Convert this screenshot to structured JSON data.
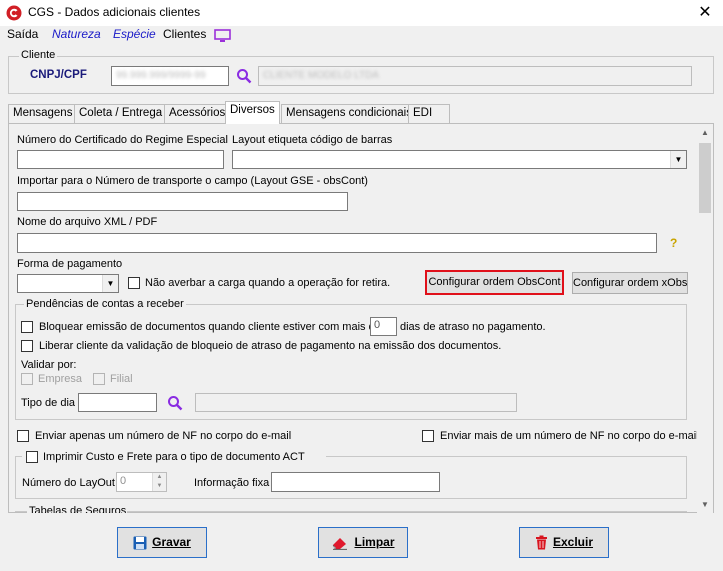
{
  "window": {
    "title": "CGS - Dados adicionais clientes",
    "close_glyph": "✕"
  },
  "menu": {
    "items": [
      "Saída",
      "Natureza",
      "Espécie",
      "Clientes"
    ],
    "monitor_icon": "monitor-icon"
  },
  "cliente": {
    "group_label": "Cliente",
    "cnpj_label": "CNPJ/CPF",
    "cnpj_value": "99.999.999/9999-99",
    "name_value": "CLIENTE MODELO LTDA"
  },
  "tabs": [
    "Mensagens",
    "Coleta / Entrega",
    "Acessórios",
    "Diversos",
    "Mensagens condicionais",
    "EDI"
  ],
  "diversos": {
    "cert_label": "Número do Certificado do Regime Especial",
    "cert_value": "",
    "layout_label": "Layout etiqueta código de barras",
    "layout_value": "",
    "import_label": "Importar para o Número de transporte o campo (Layout GSE - obsCont)",
    "import_value": "",
    "xml_label": "Nome do arquivo XML / PDF",
    "xml_value": "",
    "help_glyph": "?",
    "forma_label": "Forma de pagamento",
    "forma_value": "",
    "nao_averbar_label": "Não averbar a carga quando a operação for retira.",
    "btn_obscont": "Configurar ordem ObsCont",
    "btn_xobs": "Configurar ordem xObs",
    "pendencias": {
      "group_label": "Pendências de contas a receber",
      "bloquear_label": "Bloquear emissão de documentos quando cliente estiver com mais de",
      "dias_value": "0",
      "dias_suffix": "dias de atraso no pagamento.",
      "liberar_label": "Liberar cliente da validação de bloqueio de atraso de pagamento na emissão dos documentos.",
      "validar_label": "Validar por:",
      "empresa_label": "Empresa",
      "filial_label": "Filial",
      "tipo_dia_label": "Tipo de dia",
      "tipo_dia_value": ""
    },
    "enviar_um_label": "Enviar apenas um número de NF no corpo do e-mail",
    "enviar_mais_label": "Enviar mais de um número de NF no corpo do e-mail",
    "act": {
      "group_label": "Imprimir Custo e Frete para o tipo de documento ACT",
      "layout_label": "Número do LayOut",
      "layout_value": "0",
      "info_label": "Informação fixa",
      "info_value": ""
    },
    "tabelas_label": "Tabelas de Seguros"
  },
  "footer": {
    "gravar": "Gravar",
    "limpar": "Limpar",
    "excluir": "Excluir"
  },
  "colors": {
    "highlight_border": "#e0101a",
    "accent_blue": "#1a1ac8",
    "label_navy": "#1a1a7a",
    "search_purple": "#8a2be2"
  }
}
